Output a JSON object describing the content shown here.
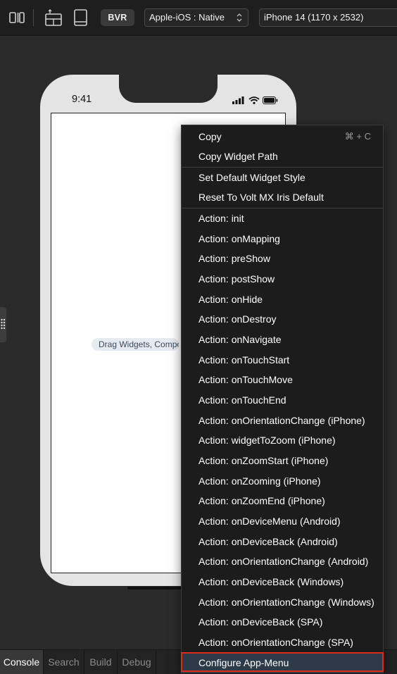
{
  "toolbar": {
    "bvr_label": "BVR",
    "platform_select": "Apple-iOS : Native",
    "device_select": "iPhone 14 (1170 x 2532)",
    "icons": [
      "split-view-icon",
      "layout-export-icon",
      "device-icon",
      "chevron-updown-icon"
    ]
  },
  "phone": {
    "time": "9:41",
    "status_icons": [
      "signal-icon",
      "wifi-icon",
      "battery-icon"
    ],
    "drag_hint": "Drag Widgets, Components"
  },
  "context_menu": {
    "items": [
      {
        "label": "Copy",
        "shortcut": "⌘ + C"
      },
      {
        "label": "Copy Widget Path"
      },
      {
        "label": "Set Default Widget Style"
      },
      {
        "label": "Reset To Volt MX Iris Default"
      },
      {
        "label": "Action: init"
      },
      {
        "label": "Action: onMapping"
      },
      {
        "label": "Action: preShow"
      },
      {
        "label": "Action: postShow"
      },
      {
        "label": "Action: onHide"
      },
      {
        "label": "Action: onDestroy"
      },
      {
        "label": "Action: onNavigate"
      },
      {
        "label": "Action: onTouchStart"
      },
      {
        "label": "Action: onTouchMove"
      },
      {
        "label": "Action: onTouchEnd"
      },
      {
        "label": "Action: onOrientationChange (iPhone)"
      },
      {
        "label": "Action: widgetToZoom (iPhone)"
      },
      {
        "label": "Action: onZoomStart (iPhone)"
      },
      {
        "label": "Action: onZooming (iPhone)"
      },
      {
        "label": "Action: onZoomEnd (iPhone)"
      },
      {
        "label": "Action: onDeviceMenu (Android)"
      },
      {
        "label": "Action: onDeviceBack (Android)"
      },
      {
        "label": "Action: onOrientationChange (Android)"
      },
      {
        "label": "Action: onDeviceBack (Windows)"
      },
      {
        "label": "Action: onOrientationChange (Windows)"
      },
      {
        "label": "Action: onDeviceBack (SPA)"
      },
      {
        "label": "Action: onOrientationChange (SPA)"
      },
      {
        "label": "Configure App-Menu"
      }
    ],
    "highlight_color": "#e02a1a"
  },
  "bottom_tabs": [
    "Console",
    "Search",
    "Build",
    "Debug"
  ],
  "colors": {
    "background": "#2b2b2b",
    "menu_bg": "#1c1c1c",
    "highlight_border": "#e02a1a"
  }
}
